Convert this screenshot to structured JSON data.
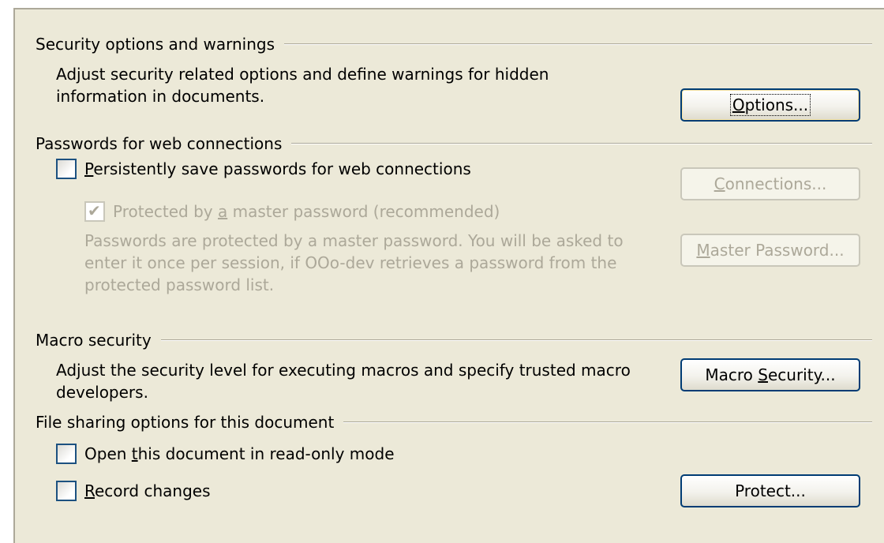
{
  "security": {
    "title": "Security options and warnings",
    "desc_line1": "Adjust security related options and define warnings for hidden",
    "desc_line2": "information in documents.",
    "options_pre": "",
    "options_key": "O",
    "options_post": "ptions..."
  },
  "passwords": {
    "title": "Passwords for web connections",
    "persist_key": "P",
    "persist_post": "ersistently save passwords for web connections",
    "persist_checked": false,
    "master_pre": "Protected by ",
    "master_key": "a",
    "master_post": " master password (recommended)",
    "master_checked": true,
    "info_line1": "Passwords are protected by a master password. You will be asked to",
    "info_line2": "enter it once per session, if OOo-dev retrieves a password from the",
    "info_line3": "protected password list.",
    "connections_key": "C",
    "connections_post": "onnections...",
    "master_btn_key": "M",
    "master_btn_post": "aster Password..."
  },
  "macro": {
    "title": "Macro security",
    "desc_line1": "Adjust the security level for executing macros and specify trusted macro",
    "desc_line2": "developers.",
    "btn_pre": "Macro ",
    "btn_key": "S",
    "btn_post": "ecurity..."
  },
  "sharing": {
    "title": "File sharing options for this document",
    "readonly_pre": "Open ",
    "readonly_key": "t",
    "readonly_post": "his document in read-only mode",
    "readonly_checked": false,
    "record_key": "R",
    "record_post": "ecord changes",
    "record_checked": false,
    "protect_label": "Protect..."
  }
}
